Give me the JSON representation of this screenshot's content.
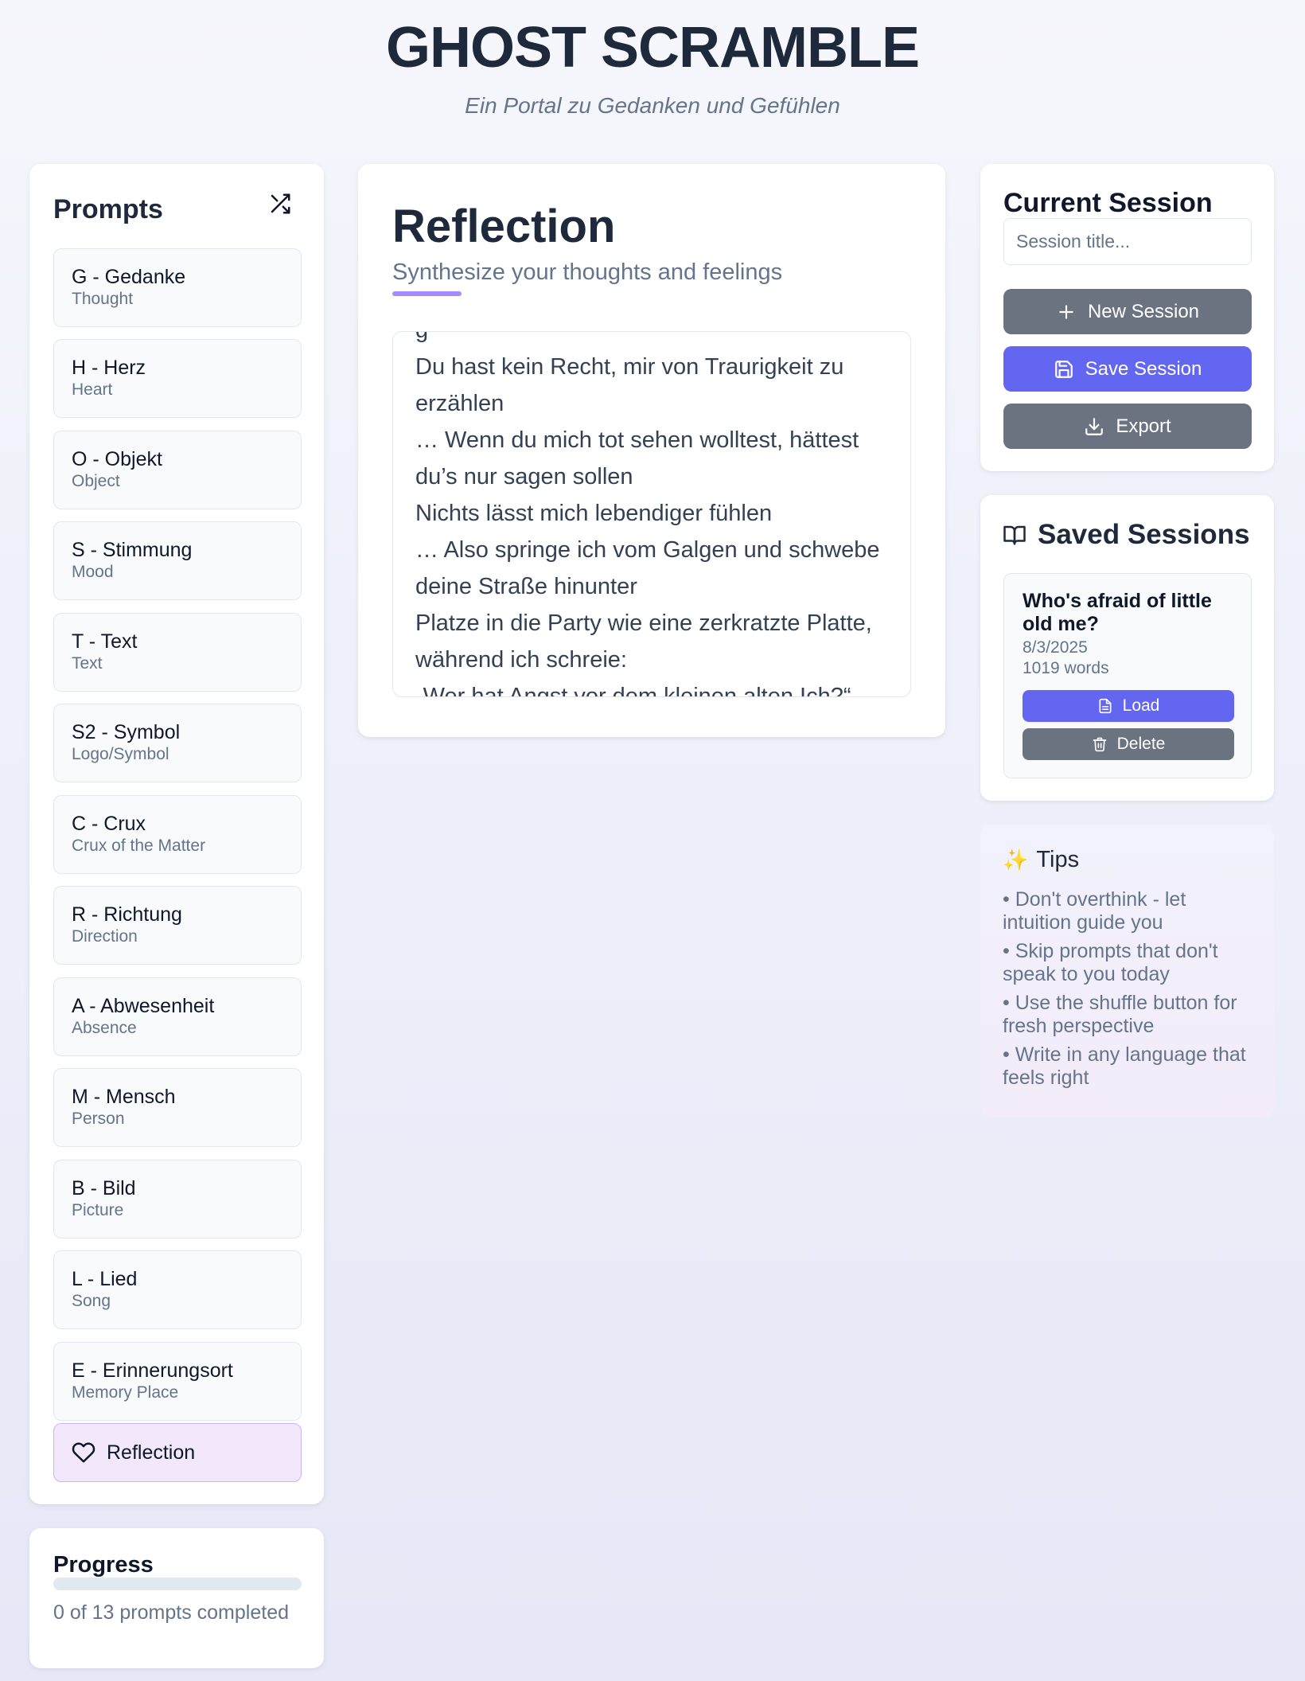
{
  "header": {
    "title": "GHOST SCRAMBLE",
    "subtitle": "Ein Portal zu Gedanken und Gefühlen"
  },
  "prompts": {
    "title": "Prompts",
    "shuffle_icon": "shuffle-icon",
    "items": [
      {
        "name": "G - Gedanke",
        "sub": "Thought"
      },
      {
        "name": "H - Herz",
        "sub": "Heart"
      },
      {
        "name": "O - Objekt",
        "sub": "Object"
      },
      {
        "name": "S - Stimmung",
        "sub": "Mood"
      },
      {
        "name": "T - Text",
        "sub": "Text"
      },
      {
        "name": "S2 - Symbol",
        "sub": "Logo/Symbol"
      },
      {
        "name": "C - Crux",
        "sub": "Crux of the Matter"
      },
      {
        "name": "R - Richtung",
        "sub": "Direction"
      },
      {
        "name": "A - Abwesenheit",
        "sub": "Absence"
      },
      {
        "name": "M - Mensch",
        "sub": "Person"
      },
      {
        "name": "B - Bild",
        "sub": "Picture"
      },
      {
        "name": "L - Lied",
        "sub": "Song"
      },
      {
        "name": "E - Erinnerungsort",
        "sub": "Memory Place"
      }
    ],
    "reflection_label": "Reflection",
    "reflection_icon": "heart-icon"
  },
  "progress": {
    "title": "Progress",
    "completed": 0,
    "total": 13,
    "fraction": 0,
    "text": "0 of 13 prompts completed"
  },
  "main": {
    "title": "Reflection",
    "subtitle": "Synthesize your thoughts and feelings",
    "accent_color": "#a78bfa",
    "editor_lines": [
      "g",
      "Du hast kein Recht, mir von Traurigkeit zu",
      "erzählen",
      "… Wenn du mich tot sehen wolltest, hättest",
      "du’s nur sagen sollen",
      "Nichts lässt mich lebendiger fühlen",
      "… Also springe ich vom Galgen und schwebe",
      "deine Straße hinunter",
      "Platze in die Party wie eine zerkratzte Platte,",
      "während ich schreie:",
      "„Wer hat Angst vor dem kleinen alten Ich?“"
    ]
  },
  "session": {
    "title": "Current Session",
    "input_placeholder": "Session title...",
    "input_value": "",
    "new_label": "New Session",
    "save_label": "Save Session",
    "export_label": "Export",
    "colors": {
      "gray": "#6b7280",
      "purple": "#6366f1"
    }
  },
  "saved": {
    "title": "Saved Sessions",
    "icon": "book-icon",
    "entries": [
      {
        "title": "Who's afraid of little old me?",
        "date": "8/3/2025",
        "words": "1019 words",
        "load_label": "Load",
        "delete_label": "Delete"
      }
    ]
  },
  "tips": {
    "icon": "✨",
    "title": "Tips",
    "items": [
      "• Don't overthink - let intuition guide you",
      "• Skip prompts that don't speak to you today",
      "• Use the shuffle button for fresh perspective",
      "• Write in any language that feels right"
    ]
  }
}
